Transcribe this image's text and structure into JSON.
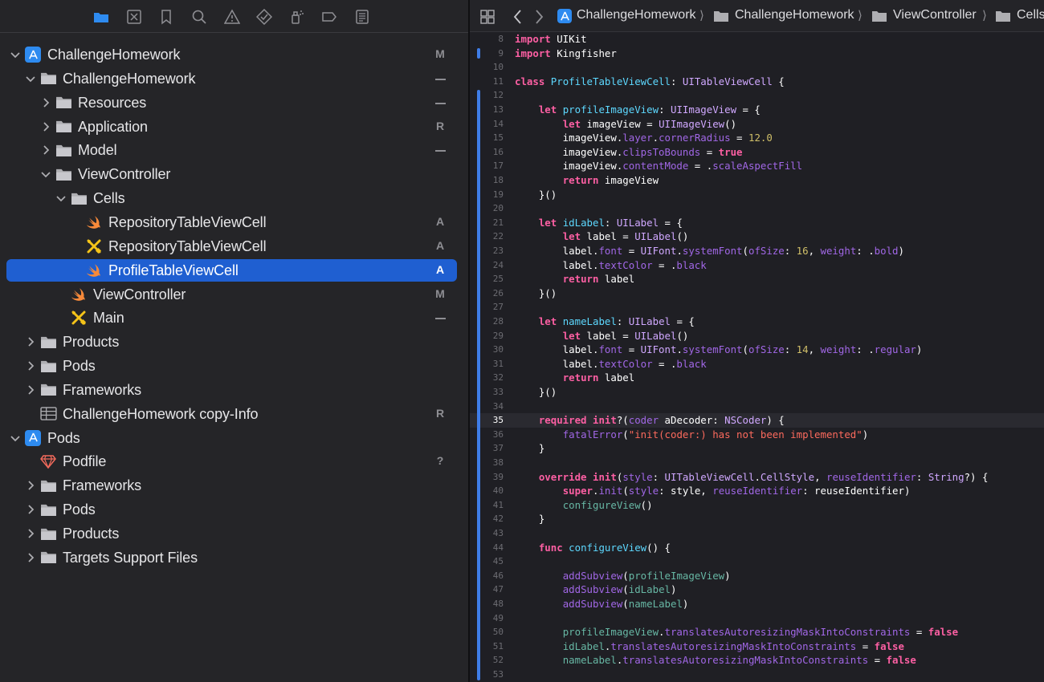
{
  "navigator": {
    "items": [
      {
        "label": "ChallengeHomework",
        "status": "M",
        "icon": "xcode-project-icon",
        "level": 0,
        "expanded": true
      },
      {
        "label": "ChallengeHomework",
        "status": "",
        "dash": true,
        "icon": "folder-icon",
        "level": 1,
        "expanded": true
      },
      {
        "label": "Resources",
        "status": "",
        "dash": true,
        "icon": "folder-icon",
        "level": 2,
        "expanded": false
      },
      {
        "label": "Application",
        "status": "R",
        "icon": "folder-icon",
        "level": 2,
        "expanded": false
      },
      {
        "label": "Model",
        "status": "",
        "dash": true,
        "icon": "folder-icon",
        "level": 2,
        "expanded": false
      },
      {
        "label": "ViewController",
        "status": "",
        "icon": "folder-icon",
        "level": 2,
        "expanded": true
      },
      {
        "label": "Cells",
        "status": "",
        "icon": "folder-icon",
        "level": 3,
        "expanded": true
      },
      {
        "label": "RepositoryTableViewCell",
        "status": "A",
        "icon": "swift-file-icon",
        "level": 4
      },
      {
        "label": "RepositoryTableViewCell",
        "status": "A",
        "icon": "xib-file-icon",
        "level": 4
      },
      {
        "label": "ProfileTableViewCell",
        "status": "A",
        "icon": "swift-file-icon",
        "level": 4,
        "selected": true
      },
      {
        "label": "ViewController",
        "status": "M",
        "icon": "swift-file-icon",
        "level": 3
      },
      {
        "label": "Main",
        "status": "",
        "dash": true,
        "icon": "xib-file-icon",
        "level": 3
      },
      {
        "label": "Products",
        "status": "",
        "icon": "folder-icon",
        "level": 1,
        "expanded": false
      },
      {
        "label": "Pods",
        "status": "",
        "icon": "folder-icon",
        "level": 1,
        "expanded": false
      },
      {
        "label": "Frameworks",
        "status": "",
        "icon": "folder-icon",
        "level": 1,
        "expanded": false
      },
      {
        "label": "ChallengeHomework copy-Info",
        "status": "R",
        "icon": "plist-file-icon",
        "level": 1
      },
      {
        "label": "Pods",
        "status": "",
        "icon": "xcode-project-icon",
        "level": 0,
        "expanded": true
      },
      {
        "label": "Podfile",
        "status": "?",
        "icon": "ruby-file-icon",
        "level": 1
      },
      {
        "label": "Frameworks",
        "status": "",
        "icon": "folder-icon",
        "level": 1,
        "expanded": false
      },
      {
        "label": "Pods",
        "status": "",
        "icon": "folder-icon",
        "level": 1,
        "expanded": false
      },
      {
        "label": "Products",
        "status": "",
        "icon": "folder-icon",
        "level": 1,
        "expanded": false
      },
      {
        "label": "Targets Support Files",
        "status": "",
        "icon": "folder-icon",
        "level": 1,
        "expanded": false
      }
    ]
  },
  "jumpbar": {
    "crumbs": [
      "ChallengeHomework",
      "ChallengeHomework",
      "ViewController",
      "Cells"
    ]
  },
  "editor": {
    "current_line": 35,
    "lines": [
      {
        "n": 8,
        "t": [
          [
            "kw",
            "import"
          ],
          [
            "pl",
            " UIKit"
          ]
        ]
      },
      {
        "n": 9,
        "t": [
          [
            "kw",
            "import"
          ],
          [
            "pl",
            " Kingfisher"
          ]
        ]
      },
      {
        "n": 10,
        "t": []
      },
      {
        "n": 11,
        "t": [
          [
            "kw",
            "class"
          ],
          [
            "pl",
            " "
          ],
          [
            "dc",
            "ProfileTableViewCell"
          ],
          [
            "pl",
            ": "
          ],
          [
            "ty",
            "UITableViewCell"
          ],
          [
            "pl",
            " {"
          ]
        ]
      },
      {
        "n": 12,
        "t": []
      },
      {
        "n": 13,
        "t": [
          [
            "pl",
            "    "
          ],
          [
            "kw",
            "let"
          ],
          [
            "pl",
            " "
          ],
          [
            "dc",
            "profileImageView"
          ],
          [
            "pl",
            ": "
          ],
          [
            "ty",
            "UIImageView"
          ],
          [
            "pl",
            " = {"
          ]
        ]
      },
      {
        "n": 14,
        "t": [
          [
            "pl",
            "        "
          ],
          [
            "kw",
            "let"
          ],
          [
            "pl",
            " imageView = "
          ],
          [
            "ty",
            "UIImageView"
          ],
          [
            "pl",
            "()"
          ]
        ]
      },
      {
        "n": 15,
        "t": [
          [
            "pl",
            "        imageView."
          ],
          [
            "pr",
            "layer"
          ],
          [
            "pl",
            "."
          ],
          [
            "pr",
            "cornerRadius"
          ],
          [
            "pl",
            " = "
          ],
          [
            "nu",
            "12.0"
          ]
        ]
      },
      {
        "n": 16,
        "t": [
          [
            "pl",
            "        imageView."
          ],
          [
            "pr",
            "clipsToBounds"
          ],
          [
            "pl",
            " = "
          ],
          [
            "kw",
            "true"
          ]
        ]
      },
      {
        "n": 17,
        "t": [
          [
            "pl",
            "        imageView."
          ],
          [
            "pr",
            "contentMode"
          ],
          [
            "pl",
            " = ."
          ],
          [
            "pr",
            "scaleAspectFill"
          ]
        ]
      },
      {
        "n": 18,
        "t": [
          [
            "pl",
            "        "
          ],
          [
            "kw",
            "return"
          ],
          [
            "pl",
            " imageView"
          ]
        ]
      },
      {
        "n": 19,
        "t": [
          [
            "pl",
            "    }()"
          ]
        ]
      },
      {
        "n": 20,
        "t": []
      },
      {
        "n": 21,
        "t": [
          [
            "pl",
            "    "
          ],
          [
            "kw",
            "let"
          ],
          [
            "pl",
            " "
          ],
          [
            "dc",
            "idLabel"
          ],
          [
            "pl",
            ": "
          ],
          [
            "ty",
            "UILabel"
          ],
          [
            "pl",
            " = {"
          ]
        ]
      },
      {
        "n": 22,
        "t": [
          [
            "pl",
            "        "
          ],
          [
            "kw",
            "let"
          ],
          [
            "pl",
            " label = "
          ],
          [
            "ty",
            "UILabel"
          ],
          [
            "pl",
            "()"
          ]
        ]
      },
      {
        "n": 23,
        "t": [
          [
            "pl",
            "        label."
          ],
          [
            "pr",
            "font"
          ],
          [
            "pl",
            " = "
          ],
          [
            "ty",
            "UIFont"
          ],
          [
            "pl",
            "."
          ],
          [
            "pr",
            "systemFont"
          ],
          [
            "pl",
            "("
          ],
          [
            "pr",
            "ofSize"
          ],
          [
            "pl",
            ": "
          ],
          [
            "nu",
            "16"
          ],
          [
            "pl",
            ", "
          ],
          [
            "pr",
            "weight"
          ],
          [
            "pl",
            ": ."
          ],
          [
            "pr",
            "bold"
          ],
          [
            "pl",
            ")"
          ]
        ]
      },
      {
        "n": 24,
        "t": [
          [
            "pl",
            "        label."
          ],
          [
            "pr",
            "textColor"
          ],
          [
            "pl",
            " = ."
          ],
          [
            "pr",
            "black"
          ]
        ]
      },
      {
        "n": 25,
        "t": [
          [
            "pl",
            "        "
          ],
          [
            "kw",
            "return"
          ],
          [
            "pl",
            " label"
          ]
        ]
      },
      {
        "n": 26,
        "t": [
          [
            "pl",
            "    }()"
          ]
        ]
      },
      {
        "n": 27,
        "t": []
      },
      {
        "n": 28,
        "t": [
          [
            "pl",
            "    "
          ],
          [
            "kw",
            "let"
          ],
          [
            "pl",
            " "
          ],
          [
            "dc",
            "nameLabel"
          ],
          [
            "pl",
            ": "
          ],
          [
            "ty",
            "UILabel"
          ],
          [
            "pl",
            " = {"
          ]
        ]
      },
      {
        "n": 29,
        "t": [
          [
            "pl",
            "        "
          ],
          [
            "kw",
            "let"
          ],
          [
            "pl",
            " label = "
          ],
          [
            "ty",
            "UILabel"
          ],
          [
            "pl",
            "()"
          ]
        ]
      },
      {
        "n": 30,
        "t": [
          [
            "pl",
            "        label."
          ],
          [
            "pr",
            "font"
          ],
          [
            "pl",
            " = "
          ],
          [
            "ty",
            "UIFont"
          ],
          [
            "pl",
            "."
          ],
          [
            "pr",
            "systemFont"
          ],
          [
            "pl",
            "("
          ],
          [
            "pr",
            "ofSize"
          ],
          [
            "pl",
            ": "
          ],
          [
            "nu",
            "14"
          ],
          [
            "pl",
            ", "
          ],
          [
            "pr",
            "weight"
          ],
          [
            "pl",
            ": ."
          ],
          [
            "pr",
            "regular"
          ],
          [
            "pl",
            ")"
          ]
        ]
      },
      {
        "n": 31,
        "t": [
          [
            "pl",
            "        label."
          ],
          [
            "pr",
            "textColor"
          ],
          [
            "pl",
            " = ."
          ],
          [
            "pr",
            "black"
          ]
        ]
      },
      {
        "n": 32,
        "t": [
          [
            "pl",
            "        "
          ],
          [
            "kw",
            "return"
          ],
          [
            "pl",
            " label"
          ]
        ]
      },
      {
        "n": 33,
        "t": [
          [
            "pl",
            "    }()"
          ]
        ]
      },
      {
        "n": 34,
        "t": []
      },
      {
        "n": 35,
        "t": [
          [
            "pl",
            "    "
          ],
          [
            "kw",
            "required"
          ],
          [
            "pl",
            " "
          ],
          [
            "kw",
            "init"
          ],
          [
            "pl",
            "?("
          ],
          [
            "pr",
            "coder"
          ],
          [
            "pl",
            " aDecoder: "
          ],
          [
            "ty",
            "NSCoder"
          ],
          [
            "pl",
            ") {"
          ]
        ]
      },
      {
        "n": 36,
        "t": [
          [
            "pl",
            "        "
          ],
          [
            "pr",
            "fatalError"
          ],
          [
            "pl",
            "("
          ],
          [
            "st",
            "\"init(coder:) has not been implemented\""
          ],
          [
            "pl",
            ")"
          ]
        ]
      },
      {
        "n": 37,
        "t": [
          [
            "pl",
            "    }"
          ]
        ]
      },
      {
        "n": 38,
        "t": []
      },
      {
        "n": 39,
        "t": [
          [
            "pl",
            "    "
          ],
          [
            "kw",
            "override"
          ],
          [
            "pl",
            " "
          ],
          [
            "kw",
            "init"
          ],
          [
            "pl",
            "("
          ],
          [
            "pr",
            "style"
          ],
          [
            "pl",
            ": "
          ],
          [
            "ty",
            "UITableViewCell"
          ],
          [
            "pl",
            "."
          ],
          [
            "ty",
            "CellStyle"
          ],
          [
            "pl",
            ", "
          ],
          [
            "pr",
            "reuseIdentifier"
          ],
          [
            "pl",
            ": "
          ],
          [
            "ty",
            "String"
          ],
          [
            "pl",
            "?) {"
          ]
        ]
      },
      {
        "n": 40,
        "t": [
          [
            "pl",
            "        "
          ],
          [
            "kw",
            "super"
          ],
          [
            "pl",
            "."
          ],
          [
            "pr",
            "init"
          ],
          [
            "pl",
            "("
          ],
          [
            "pr",
            "style"
          ],
          [
            "pl",
            ": style, "
          ],
          [
            "pr",
            "reuseIdentifier"
          ],
          [
            "pl",
            ": reuseIdentifier)"
          ]
        ]
      },
      {
        "n": 41,
        "t": [
          [
            "pl",
            "        "
          ],
          [
            "fn",
            "configureView"
          ],
          [
            "pl",
            "()"
          ]
        ]
      },
      {
        "n": 42,
        "t": [
          [
            "pl",
            "    }"
          ]
        ]
      },
      {
        "n": 43,
        "t": []
      },
      {
        "n": 44,
        "t": [
          [
            "pl",
            "    "
          ],
          [
            "kw",
            "func"
          ],
          [
            "pl",
            " "
          ],
          [
            "dc",
            "configureView"
          ],
          [
            "pl",
            "() {"
          ]
        ]
      },
      {
        "n": 45,
        "t": []
      },
      {
        "n": 46,
        "t": [
          [
            "pl",
            "        "
          ],
          [
            "pr",
            "addSubview"
          ],
          [
            "pl",
            "("
          ],
          [
            "fn",
            "profileImageView"
          ],
          [
            "pl",
            ")"
          ]
        ]
      },
      {
        "n": 47,
        "t": [
          [
            "pl",
            "        "
          ],
          [
            "pr",
            "addSubview"
          ],
          [
            "pl",
            "("
          ],
          [
            "fn",
            "idLabel"
          ],
          [
            "pl",
            ")"
          ]
        ]
      },
      {
        "n": 48,
        "t": [
          [
            "pl",
            "        "
          ],
          [
            "pr",
            "addSubview"
          ],
          [
            "pl",
            "("
          ],
          [
            "fn",
            "nameLabel"
          ],
          [
            "pl",
            ")"
          ]
        ]
      },
      {
        "n": 49,
        "t": []
      },
      {
        "n": 50,
        "t": [
          [
            "pl",
            "        "
          ],
          [
            "fn",
            "profileImageView"
          ],
          [
            "pl",
            "."
          ],
          [
            "pr",
            "translatesAutoresizingMaskIntoConstraints"
          ],
          [
            "pl",
            " = "
          ],
          [
            "kw",
            "false"
          ]
        ]
      },
      {
        "n": 51,
        "t": [
          [
            "pl",
            "        "
          ],
          [
            "fn",
            "idLabel"
          ],
          [
            "pl",
            "."
          ],
          [
            "pr",
            "translatesAutoresizingMaskIntoConstraints"
          ],
          [
            "pl",
            " = "
          ],
          [
            "kw",
            "false"
          ]
        ]
      },
      {
        "n": 52,
        "t": [
          [
            "pl",
            "        "
          ],
          [
            "fn",
            "nameLabel"
          ],
          [
            "pl",
            "."
          ],
          [
            "pr",
            "translatesAutoresizingMaskIntoConstraints"
          ],
          [
            "pl",
            " = "
          ],
          [
            "kw",
            "false"
          ]
        ]
      },
      {
        "n": 53,
        "t": []
      }
    ]
  },
  "colors": {
    "selection": "#1f5fd1",
    "swift": "#f88a3a",
    "xib": "#f4c319",
    "project": "#2e8bf0",
    "change_bar": "#3f7de8"
  }
}
